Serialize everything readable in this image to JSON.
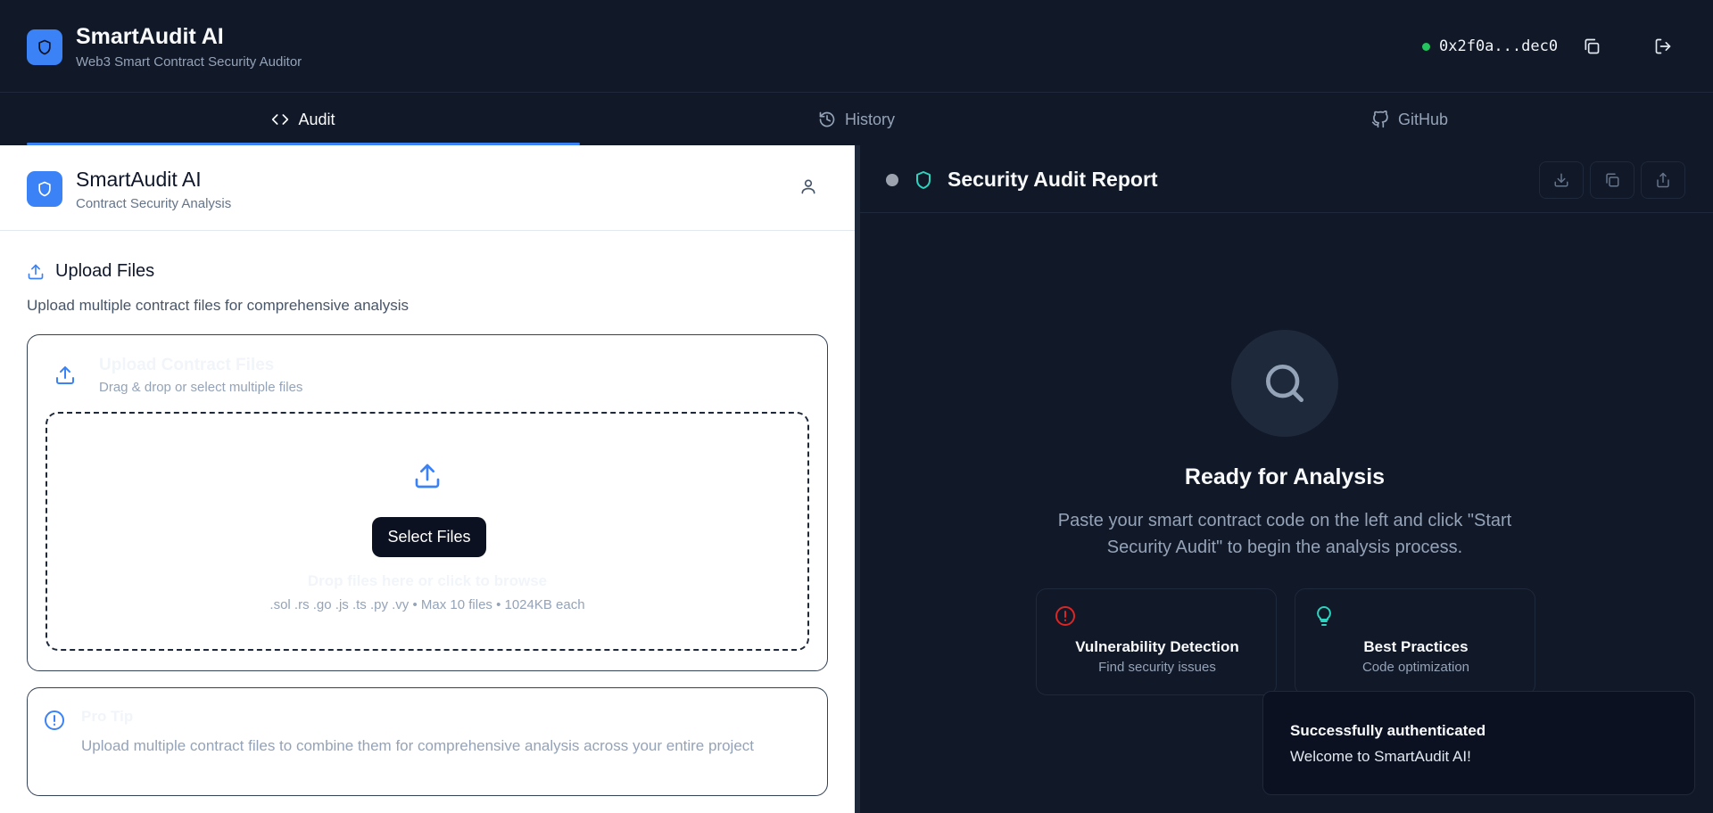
{
  "header": {
    "title": "SmartAudit AI",
    "subtitle": "Web3 Smart Contract Security Auditor",
    "wallet_address": "0x2f0a...dec0",
    "wallet_status_color": "#22c55e",
    "copy_icon": "copy-icon",
    "logout_icon": "logout-icon"
  },
  "tabs": [
    {
      "label": "Audit",
      "icon": "code-icon",
      "active": true
    },
    {
      "label": "History",
      "icon": "history-icon",
      "active": false
    },
    {
      "label": "GitHub",
      "icon": "github-icon",
      "active": false
    }
  ],
  "left_panel": {
    "title": "SmartAudit AI",
    "subtitle": "Contract Security Analysis",
    "upload": {
      "heading": "Upload Files",
      "description": "Upload multiple contract files for comprehensive analysis",
      "card_title": "Upload Contract Files",
      "card_subtitle": "Drag & drop or select multiple files",
      "button_label": "Select Files",
      "drop_text": "Drop files here or click to browse",
      "hint": ".sol .rs .go .js .ts .py .vy • Max 10 files • 1024KB each"
    },
    "tip": {
      "title": "Pro Tip",
      "text": "Upload multiple contract files to combine them for comprehensive analysis across your entire project"
    }
  },
  "right_panel": {
    "title": "Security Audit Report",
    "ready_title": "Ready for Analysis",
    "ready_desc": "Paste your smart contract code on the left and click \"Start Security Audit\" to begin the analysis process.",
    "features": [
      {
        "title": "Vulnerability Detection",
        "subtitle": "Find security issues",
        "icon": "alert-circle-icon",
        "color": "#dc2626"
      },
      {
        "title": "Best Practices",
        "subtitle": "Code optimization",
        "icon": "lightbulb-icon",
        "color": "#2dd4bf"
      }
    ]
  },
  "toast": {
    "title": "Successfully authenticated",
    "message": "Welcome to SmartAudit AI!"
  },
  "colors": {
    "accent": "#3b82f6",
    "background": "#0f172a",
    "panel": "#111827"
  }
}
